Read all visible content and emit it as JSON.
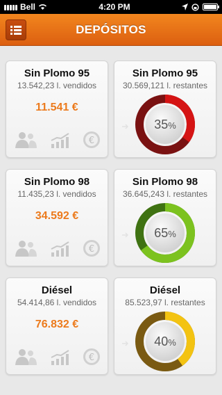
{
  "status_bar": {
    "carrier": "Bell",
    "time": "4:20 PM"
  },
  "nav": {
    "title": "DEPÓSITOS",
    "menu_icon": "list-icon"
  },
  "colors": {
    "accent": "#ec7a1c",
    "nav_top": "#f2861e",
    "nav_bottom": "#dc5f10"
  },
  "sales": [
    {
      "fuel": "Sin Plomo 95",
      "volume_text": "13.542,23 l. vendidos",
      "amount": "11.541 €"
    },
    {
      "fuel": "Sin Plomo 98",
      "volume_text": "11.435,23 l. vendidos",
      "amount": "34.592 €"
    },
    {
      "fuel": "Diésel",
      "volume_text": "54.414,86 l. vendidos",
      "amount": "76.832 €"
    }
  ],
  "tanks": [
    {
      "fuel": "Sin Plomo 95",
      "remaining_text": "30.569,121 l. restantes",
      "percent": 35,
      "percent_text": "35",
      "color": "#d51414",
      "track_color": "#7a1212"
    },
    {
      "fuel": "Sin Plomo 98",
      "remaining_text": "36.645,243 l. restantes",
      "percent": 65,
      "percent_text": "65",
      "color": "#7cc21f",
      "track_color": "#3f7212"
    },
    {
      "fuel": "Diésel",
      "remaining_text": "85.523,97 l. restantes",
      "percent": 40,
      "percent_text": "40",
      "color": "#f3c312",
      "track_color": "#7a5a12"
    }
  ],
  "percent_unit": "%"
}
